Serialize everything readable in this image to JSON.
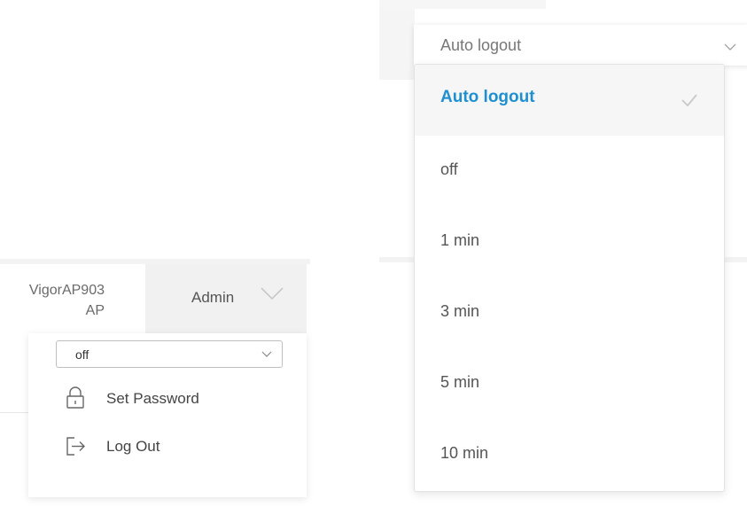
{
  "header": {
    "device_name_line1": "VigorAP903",
    "device_name_line2": "AP",
    "admin_label": "Admin"
  },
  "admin_menu": {
    "auto_logout_value": "off",
    "items": [
      {
        "label": "Set Password",
        "icon": "lock-icon"
      },
      {
        "label": "Log Out",
        "icon": "logout-icon"
      }
    ]
  },
  "auto_logout_select": {
    "value": "Auto logout",
    "options": [
      {
        "label": "Auto logout",
        "selected": true
      },
      {
        "label": "off",
        "selected": false
      },
      {
        "label": "1 min",
        "selected": false
      },
      {
        "label": "3 min",
        "selected": false
      },
      {
        "label": "5 min",
        "selected": false
      },
      {
        "label": "10 min",
        "selected": false
      }
    ]
  },
  "colors": {
    "selected_option": "#1e8fd0",
    "admin_button_bg": "#f1f1f1"
  }
}
